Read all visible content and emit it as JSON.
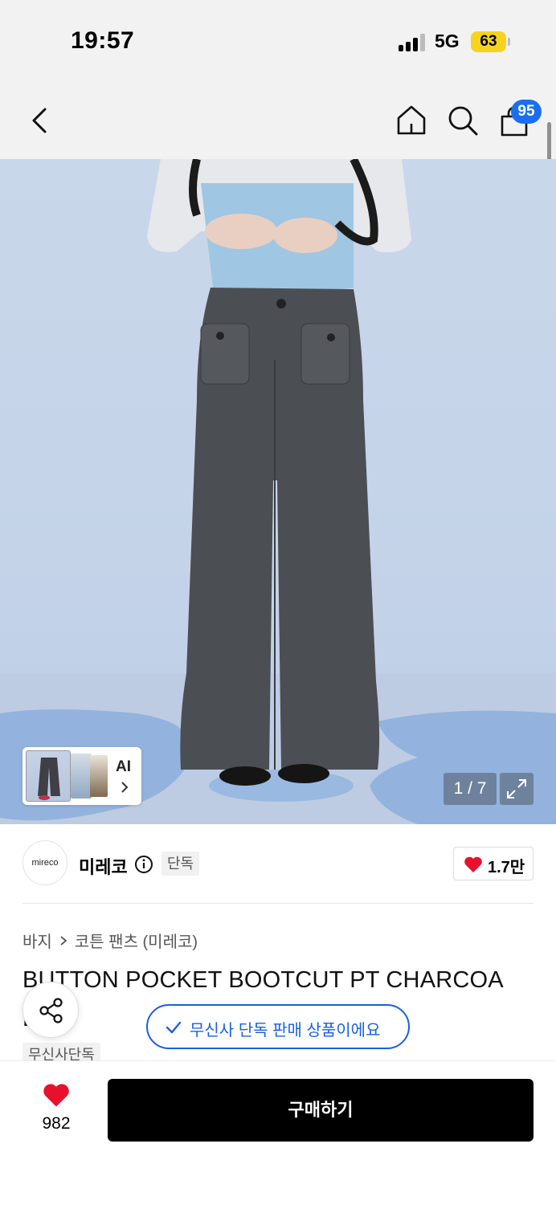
{
  "status_bar": {
    "time": "19:57",
    "network": "5G",
    "battery": "63"
  },
  "top_nav": {
    "cart_count": "95",
    "icons": [
      "back-icon",
      "home-icon",
      "search-icon",
      "bag-icon"
    ]
  },
  "gallery": {
    "ai_label": "AI",
    "counter": "1 / 7"
  },
  "brand": {
    "logo_text": "mireco",
    "name": "미레코",
    "exclusive_tag": "단독",
    "likes": "1.7만"
  },
  "product": {
    "breadcrumb": [
      "바지",
      "코튼 팬츠 (미레코)"
    ],
    "title": "BUTTON POCKET BOOTCUT PT CHARCOA",
    "title_cont": "L",
    "tag": "무신사단독"
  },
  "toast": {
    "message": "무신사 단독 판매 상품이에요"
  },
  "bottom_bar": {
    "like_count": "982",
    "buy_label": "구매하기"
  },
  "colors": {
    "accent_blue": "#1a5fe0",
    "badge_blue": "#1a6ff0",
    "heart_red": "#e8112d",
    "battery_yellow": "#f6d31f",
    "buy_button": "#000000"
  }
}
